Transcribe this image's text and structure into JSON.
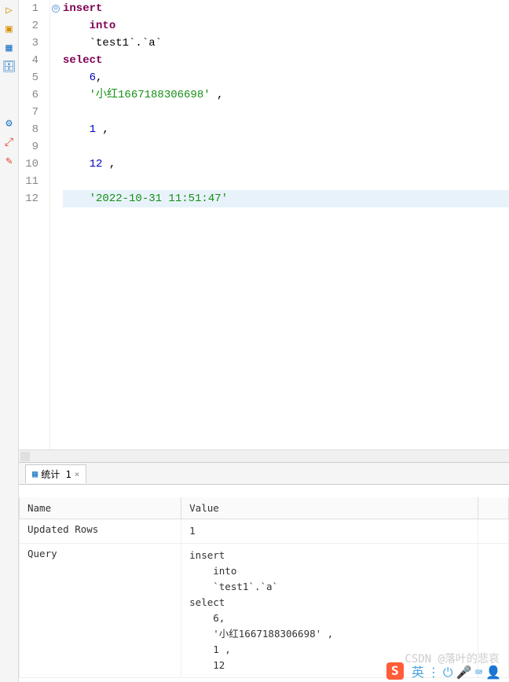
{
  "toolbar_icons": [
    {
      "name": "triangle-icon",
      "glyph": "▷",
      "color": "#d98f00"
    },
    {
      "name": "stop-icon",
      "glyph": "▣",
      "color": "#d98f00"
    },
    {
      "name": "grid-icon",
      "glyph": "▦",
      "color": "#1c77c3"
    },
    {
      "name": "db-icon",
      "glyph": "🗄",
      "color": "#1c77c3"
    },
    {
      "name": "blank1",
      "glyph": " ",
      "color": "#999"
    },
    {
      "name": "blank2",
      "glyph": " ",
      "color": "#999"
    },
    {
      "name": "gear-icon",
      "glyph": "⚙",
      "color": "#1c77c3"
    },
    {
      "name": "expand-icon",
      "glyph": "⤢",
      "color": "#e0452c"
    },
    {
      "name": "edit-icon",
      "glyph": "✎",
      "color": "#e0452c"
    }
  ],
  "code": {
    "fold_marker": "⊖",
    "lines": [
      {
        "n": 1,
        "tokens": [
          {
            "t": "insert",
            "c": "kw"
          }
        ]
      },
      {
        "n": 2,
        "tokens": [
          {
            "t": "    ",
            "c": ""
          },
          {
            "t": "into",
            "c": "kw"
          }
        ]
      },
      {
        "n": 3,
        "tokens": [
          {
            "t": "    ",
            "c": ""
          },
          {
            "t": "`test1`",
            "c": "ident"
          },
          {
            "t": ".",
            "c": "punct"
          },
          {
            "t": "`a`",
            "c": "ident"
          }
        ]
      },
      {
        "n": 4,
        "tokens": [
          {
            "t": "select",
            "c": "kw"
          }
        ]
      },
      {
        "n": 5,
        "tokens": [
          {
            "t": "    ",
            "c": ""
          },
          {
            "t": "6",
            "c": "num"
          },
          {
            "t": ",",
            "c": "punct"
          }
        ]
      },
      {
        "n": 6,
        "tokens": [
          {
            "t": "    ",
            "c": ""
          },
          {
            "t": "'小红1667188306698'",
            "c": "str"
          },
          {
            "t": " ,",
            "c": "punct"
          }
        ]
      },
      {
        "n": 7,
        "tokens": []
      },
      {
        "n": 8,
        "tokens": [
          {
            "t": "    ",
            "c": ""
          },
          {
            "t": "1",
            "c": "num"
          },
          {
            "t": " ,",
            "c": "punct"
          }
        ]
      },
      {
        "n": 9,
        "tokens": []
      },
      {
        "n": 10,
        "tokens": [
          {
            "t": "    ",
            "c": ""
          },
          {
            "t": "12",
            "c": "num"
          },
          {
            "t": " ,",
            "c": "punct"
          }
        ]
      },
      {
        "n": 11,
        "tokens": []
      },
      {
        "n": 12,
        "hl": true,
        "tokens": [
          {
            "t": "    ",
            "c": ""
          },
          {
            "t": "'2022-10-31 11:51:47'",
            "c": "str"
          }
        ]
      }
    ]
  },
  "results": {
    "tab_icon": "▦",
    "tab_label": "统计 1",
    "tab_close": "×",
    "headers": {
      "name": "Name",
      "value": "Value"
    },
    "rows": [
      {
        "name": "Updated Rows",
        "value": "1"
      },
      {
        "name": "Query",
        "value": "insert\n    into\n    `test1`.`a`\nselect\n    6,\n    '小红1667188306698' ,\n    1 ,\n    12"
      }
    ]
  },
  "watermark": "CSDN @落叶的悲哀",
  "tray": {
    "sogou": "S",
    "icons": [
      {
        "name": "cn-icon",
        "glyph": "英",
        "color": "#4aa3df"
      },
      {
        "name": "dots-icon",
        "glyph": "⋮",
        "color": "#4aa3df"
      },
      {
        "name": "power-icon",
        "glyph": "⏻",
        "color": "#4aa3df"
      },
      {
        "name": "mic-icon",
        "glyph": "🎤",
        "color": "#7cb342"
      },
      {
        "name": "keyboard-icon",
        "glyph": "⌨",
        "color": "#4aa3df"
      },
      {
        "name": "person-icon",
        "glyph": "👤",
        "color": "#4aa3df"
      }
    ]
  }
}
